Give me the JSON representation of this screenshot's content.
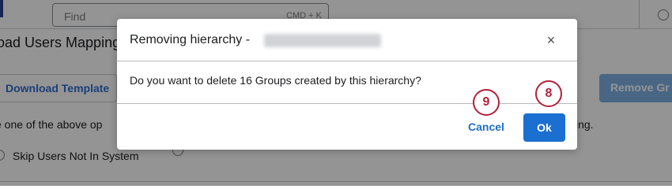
{
  "background": {
    "search": {
      "placeholder": "Find",
      "shortcut": "CMD + K"
    },
    "page_title": "load Users Mapping",
    "download_template_label": "Download Template",
    "remove_groups_label": "Remove Gr",
    "instructions_text": "e one of the above op",
    "instructions_tail": "ing.",
    "skip_users_label": "Skip Users Not In System"
  },
  "modal": {
    "title_prefix": "Removing hierarchy -",
    "close_icon": "×",
    "message": "Do you want to delete 16 Groups created by this hierarchy?",
    "cancel_label": "Cancel",
    "ok_label": "Ok"
  },
  "callouts": {
    "cancel_step": "9",
    "ok_step": "8"
  },
  "colors": {
    "primary": "#1a6fd1",
    "link": "#1f6fc5",
    "callout": "#b3203a",
    "overlay": "rgba(0,0,0,0.42)"
  }
}
